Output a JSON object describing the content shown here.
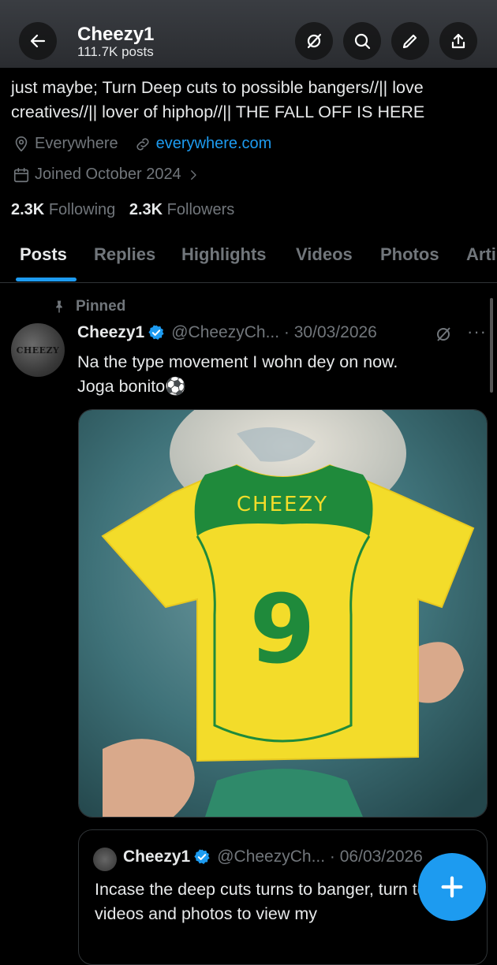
{
  "header": {
    "name": "Cheezy1",
    "posts_count": "111.7K posts",
    "icons": [
      "back-arrow-icon",
      "grok-icon",
      "search-icon",
      "edit-icon",
      "share-icon"
    ]
  },
  "profile": {
    "bio": "just maybe; Turn Deep cuts to possible bangers//|| love creatives//|| lover of hiphop//|| THE FALL OFF IS HERE",
    "location": "Everywhere",
    "website": "everywhere.com",
    "joined": "Joined October 2024",
    "following_count": "2.3K",
    "following_label": "Following",
    "followers_count": "2.3K",
    "followers_label": "Followers"
  },
  "tabs": [
    {
      "label": "Posts",
      "active": true
    },
    {
      "label": "Replies"
    },
    {
      "label": "Highlights"
    },
    {
      "label": "Videos"
    },
    {
      "label": "Photos"
    },
    {
      "label": "Arti"
    }
  ],
  "pinned_post": {
    "pinned_label": "Pinned",
    "avatar_text": "CHEEZY",
    "name": "Cheezy1",
    "handle_date": "@CheezyCh... · 30/03/2026",
    "more": "···",
    "text_line1": "Na the type movement I wohn dey on now.",
    "text_line2": "Joga bonito⚽",
    "media": {
      "jersey_name": "CHEEZY",
      "jersey_number": "9"
    }
  },
  "quoted_post": {
    "name": "Cheezy1",
    "handle_date": "@CheezyCh... · 06/03/2026",
    "text": "Incase the deep cuts turns to banger, turn to my videos and photos to view my"
  },
  "colors": {
    "accent": "#1d9bf0",
    "muted": "#71767b",
    "jersey_yellow": "#f3dc2a",
    "jersey_green": "#1f8a3b"
  }
}
